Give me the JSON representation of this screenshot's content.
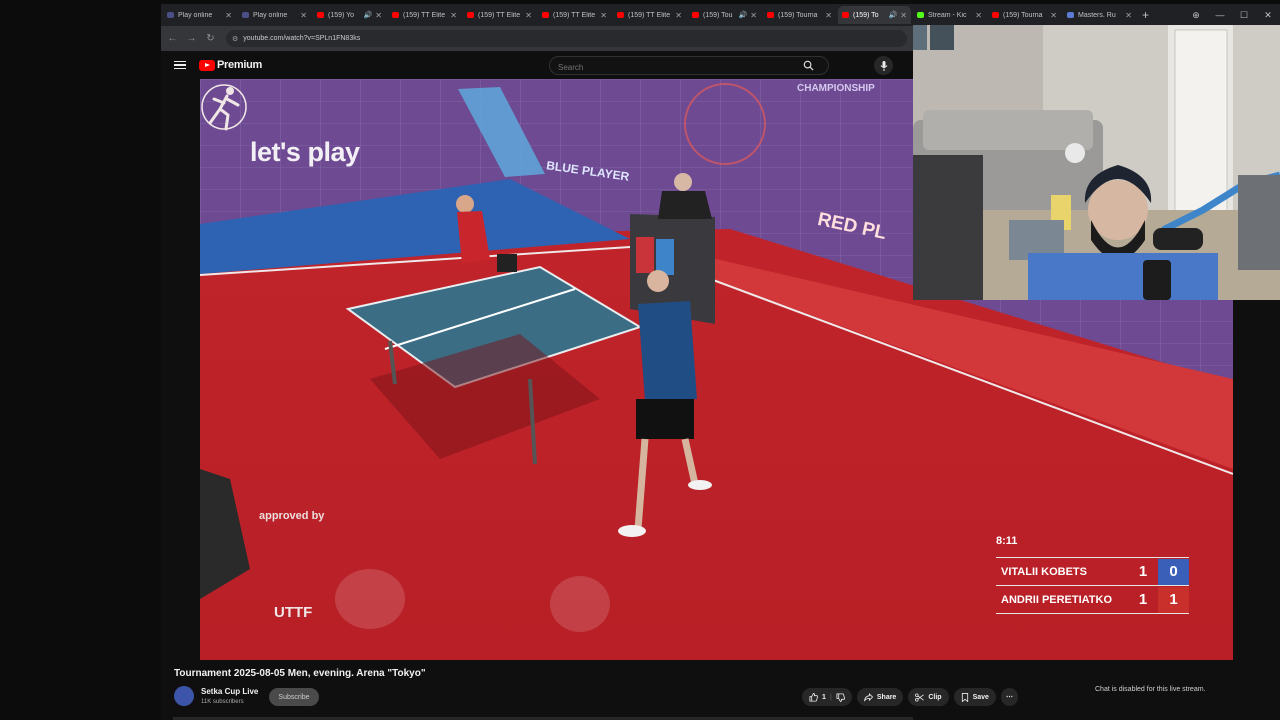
{
  "tabs": [
    {
      "title": "Play online",
      "color": "#4b4f88",
      "active": false,
      "audio": false
    },
    {
      "title": "Play online",
      "color": "#4b4f88",
      "active": false,
      "audio": false
    },
    {
      "title": "(159) Yo",
      "color": "#ff0000",
      "active": false,
      "audio": true
    },
    {
      "title": "(159) TT Elite",
      "color": "#ff0000",
      "active": false,
      "audio": false
    },
    {
      "title": "(159) TT Elite",
      "color": "#ff0000",
      "active": false,
      "audio": false
    },
    {
      "title": "(159) TT Elite",
      "color": "#ff0000",
      "active": false,
      "audio": false
    },
    {
      "title": "(159) TT Elite",
      "color": "#ff0000",
      "active": false,
      "audio": false
    },
    {
      "title": "(159) Tou",
      "color": "#ff0000",
      "active": false,
      "audio": true
    },
    {
      "title": "(159) Tourna",
      "color": "#ff0000",
      "active": false,
      "audio": false
    },
    {
      "title": "(159) To",
      "color": "#ff0000",
      "active": true,
      "audio": true
    },
    {
      "title": "Stream - Kic",
      "color": "#53fc18",
      "active": false,
      "audio": false
    },
    {
      "title": "(159) Tourna",
      "color": "#ff0000",
      "active": false,
      "audio": false
    },
    {
      "title": "Masters. Ru",
      "color": "#5b7bd5",
      "active": false,
      "audio": false
    }
  ],
  "browser": {
    "url": "youtube.com/watch?v=SPLn1FN83ks"
  },
  "youtube": {
    "brand": "Premium",
    "search_placeholder": "Search"
  },
  "video": {
    "overlay_lets_play": "let's play",
    "overlay_approved_by": "approved by",
    "overlay_uttf": "UTTF",
    "wall_blue_player": "BLUE PLAYER",
    "wall_red_player": "RED PL",
    "wall_championship": "CHAMPIONSHIP"
  },
  "scoreboard": {
    "clock": "8:11",
    "players": [
      {
        "name": "VITALII KOBETS",
        "sets": "1",
        "points": "0",
        "color": "#3a5fb8"
      },
      {
        "name": "ANDRII PERETIATKO",
        "sets": "1",
        "points": "1",
        "color": "#c9302c"
      }
    ]
  },
  "video_info": {
    "title": "Tournament 2025-08-05 Men, evening. Arena \"Tokyo\"",
    "channel_name": "Setka Cup Live",
    "subscribers": "11K subscribers",
    "subscribe_label": "Subscribe",
    "like_count": "1",
    "share_label": "Share",
    "clip_label": "Clip",
    "save_label": "Save",
    "chat_disabled": "Chat is disabled for this live stream."
  }
}
